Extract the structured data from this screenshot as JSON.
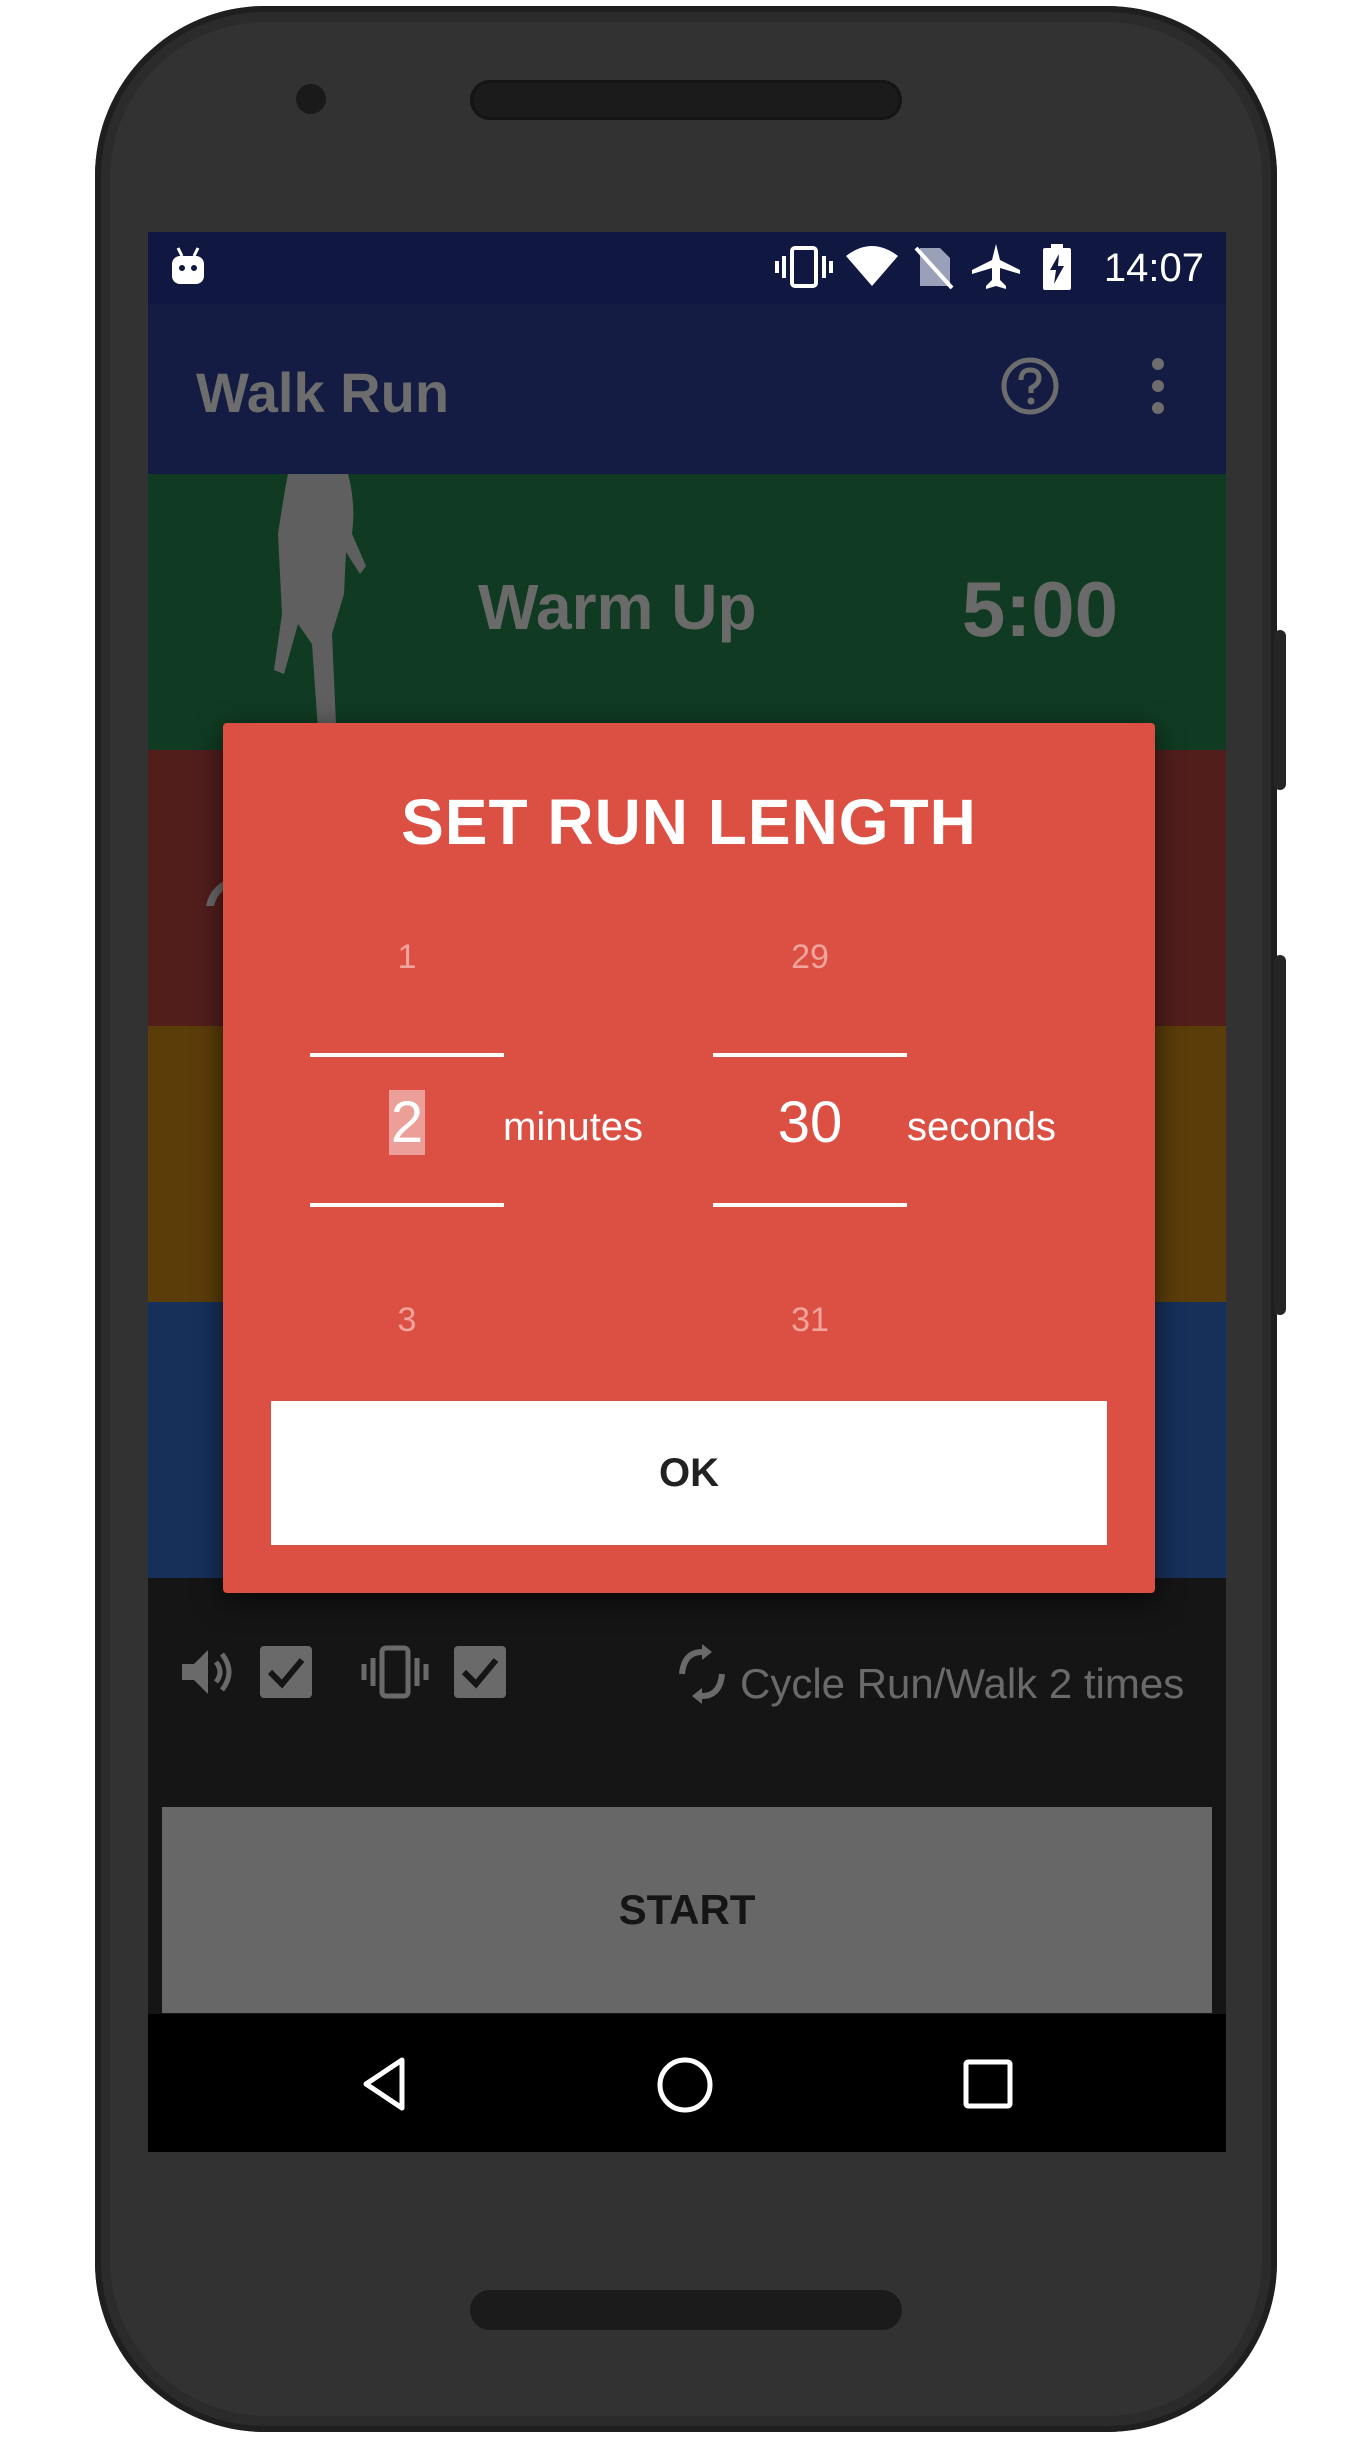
{
  "status_bar": {
    "time": "14:07"
  },
  "app_bar": {
    "title": "Walk Run"
  },
  "segments": {
    "warmup": {
      "label": "Warm Up",
      "time": "5:00"
    }
  },
  "options": {
    "cycle_text": "Cycle Run/Walk 2 times"
  },
  "start_button": {
    "label": "START"
  },
  "dialog": {
    "title": "SET RUN LENGTH",
    "minutes": {
      "prev": "1",
      "current": "2",
      "next": "3",
      "unit": "minutes"
    },
    "seconds": {
      "prev": "29",
      "current": "30",
      "next": "31",
      "unit": "seconds"
    },
    "ok_label": "OK"
  },
  "colors": {
    "status_bar": "#101842",
    "app_bar": "#151c44",
    "warmup_block": "#103b22",
    "run_block": "#521e1c",
    "walk_block": "#5b3d0a",
    "cooldown_block": "#17305a",
    "dialog": "#dc5044",
    "start_button": "#676767"
  },
  "icons": {
    "android": "android-debug-icon",
    "vibrate": "vibrate-icon",
    "wifi": "wifi-icon",
    "no_sim": "no-sim-icon",
    "airplane": "airplane-icon",
    "battery": "battery-charging-icon",
    "help": "help-icon",
    "overflow": "more-vert-icon",
    "sound": "volume-icon",
    "checkbox": "checkbox-checked-icon",
    "cycle": "cycle-icon",
    "back": "back-icon",
    "home": "home-icon",
    "recents": "recents-icon"
  }
}
